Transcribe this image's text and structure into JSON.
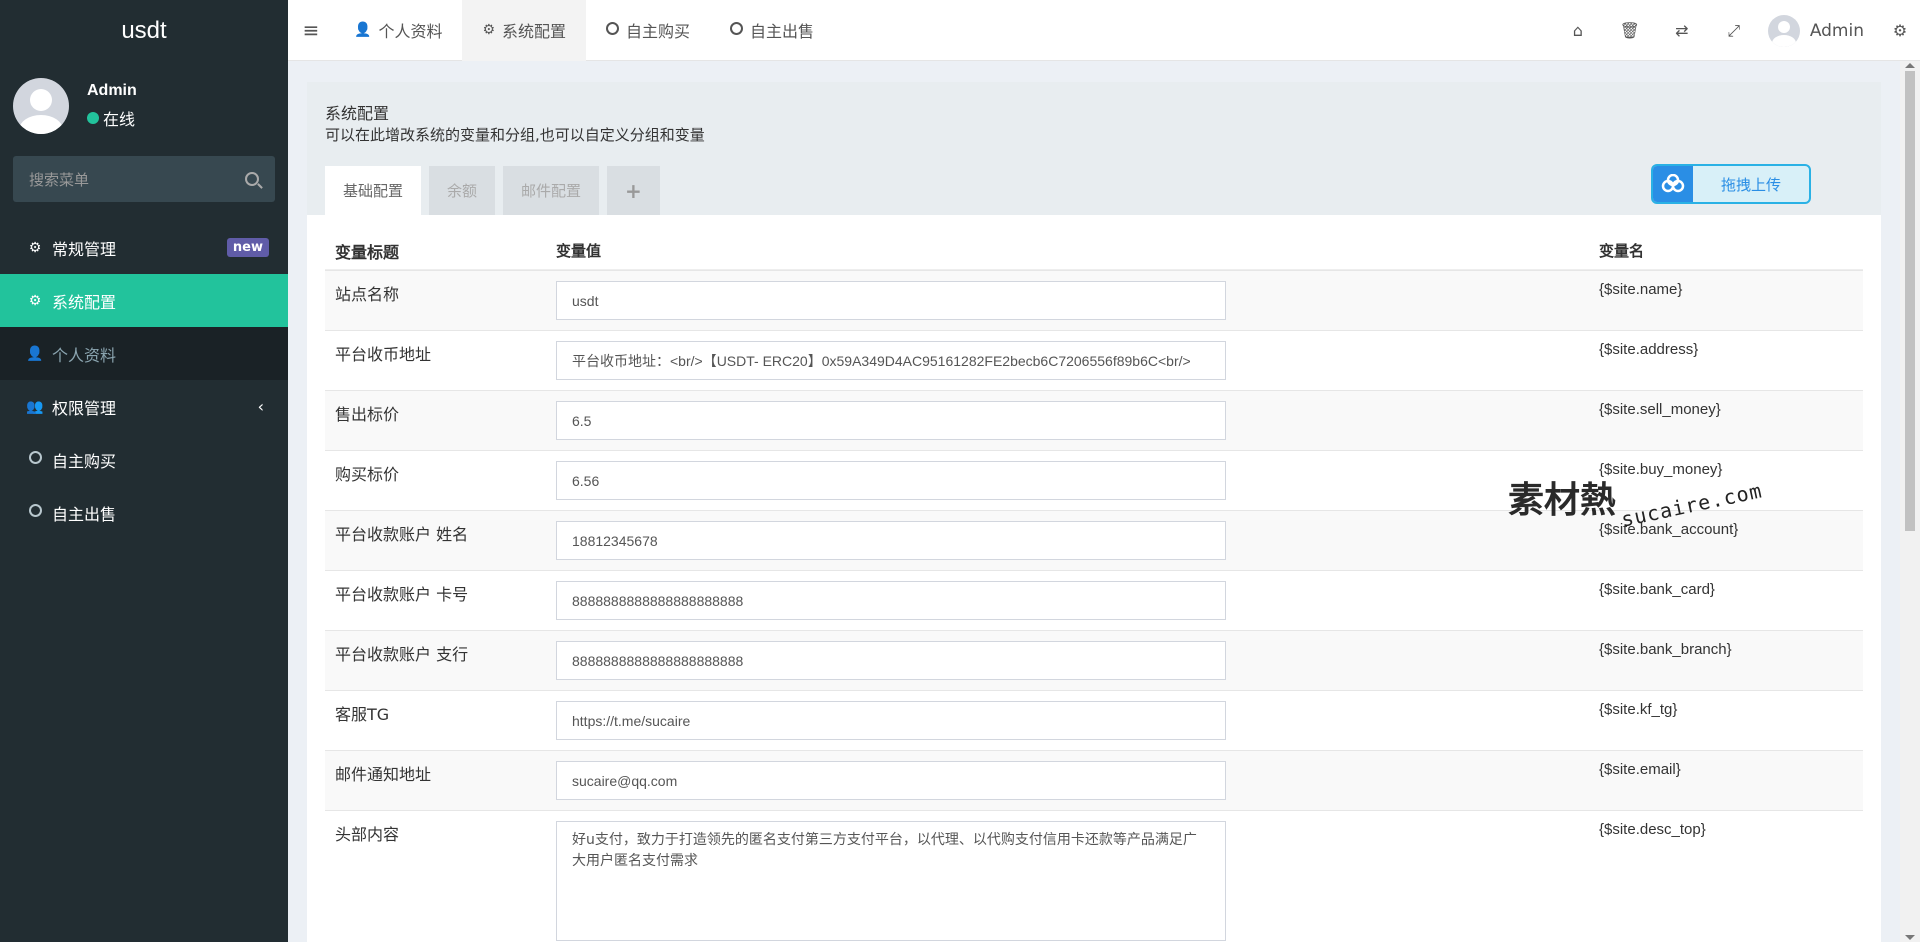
{
  "app": {
    "logo": "usdt"
  },
  "user": {
    "name": "Admin",
    "status": "在线"
  },
  "sidebar": {
    "search_placeholder": "搜索菜单",
    "items": [
      {
        "label": "常规管理",
        "badge": "new"
      },
      {
        "label": "系统配置"
      },
      {
        "label": "个人资料"
      },
      {
        "label": "权限管理"
      },
      {
        "label": "自主购买"
      },
      {
        "label": "自主出售"
      }
    ]
  },
  "navbar": {
    "tabs": [
      {
        "label": "个人资料"
      },
      {
        "label": "系统配置"
      },
      {
        "label": "自主购买"
      },
      {
        "label": "自主出售"
      }
    ],
    "user": "Admin"
  },
  "panel": {
    "title": "系统配置",
    "description": "可以在此增改系统的变量和分组,也可以自定义分组和变量",
    "tabs": [
      "基础配置",
      "余额",
      "邮件配置",
      "+"
    ],
    "upload_label": "拖拽上传"
  },
  "table": {
    "headers": [
      "变量标题",
      "变量值",
      "变量名"
    ],
    "rows": [
      {
        "title": "站点名称",
        "value": "usdt",
        "name": "{$site.name}"
      },
      {
        "title": "平台收币地址",
        "value": "平台收币地址：<br/>【USDT- ERC20】0x59A349D4AC95161282FE2becb6C7206556f89b6C<br/>",
        "name": "{$site.address}"
      },
      {
        "title": "售出标价",
        "value": "6.5",
        "name": "{$site.sell_money}"
      },
      {
        "title": "购买标价",
        "value": "6.56",
        "name": "{$site.buy_money}"
      },
      {
        "title": "平台收款账户 姓名",
        "value": "18812345678",
        "name": "{$site.bank_account}"
      },
      {
        "title": "平台收款账户 卡号",
        "value": "8888888888888888888888",
        "name": "{$site.bank_card}"
      },
      {
        "title": "平台收款账户 支行",
        "value": "8888888888888888888888",
        "name": "{$site.bank_branch}"
      },
      {
        "title": "客服TG",
        "value": "https://t.me/sucaire",
        "name": "{$site.kf_tg}"
      },
      {
        "title": "邮件通知地址",
        "value": "sucaire@qq.com",
        "name": "{$site.email}"
      },
      {
        "title": "头部内容",
        "value": "好u支付，致力于打造领先的匿名支付第三方支付平台，以代理、以代购支付信用卡还款等产品满足广大用户匿名支付需求",
        "name": "{$site.desc_top}"
      }
    ]
  },
  "watermark": {
    "main": "素材熱",
    "sub": "sucaire.com"
  },
  "colors": {
    "sidebar_bg": "#222d32",
    "accent": "#22c39c",
    "badge": "#605ca8",
    "upload": "#2a8ee5"
  }
}
